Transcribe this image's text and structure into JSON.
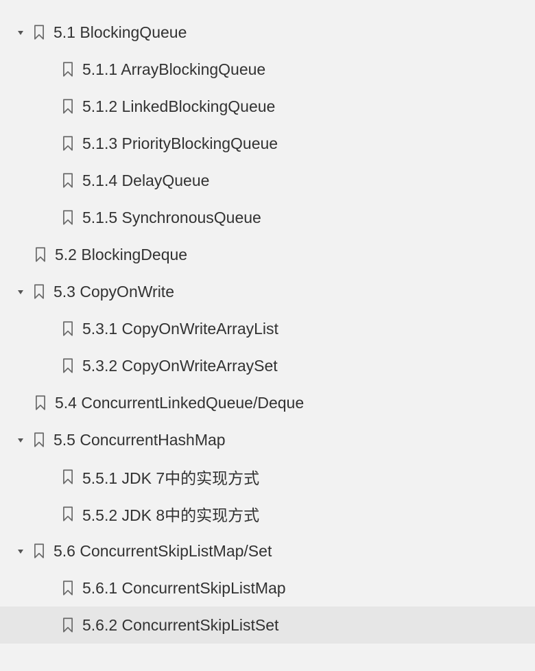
{
  "outline": [
    {
      "id": "5.1",
      "level": 1,
      "expanded": true,
      "label": "5.1 BlockingQueue"
    },
    {
      "id": "5.1.1",
      "level": 2,
      "expanded": null,
      "label": "5.1.1 ArrayBlockingQueue"
    },
    {
      "id": "5.1.2",
      "level": 2,
      "expanded": null,
      "label": "5.1.2 LinkedBlockingQueue"
    },
    {
      "id": "5.1.3",
      "level": 2,
      "expanded": null,
      "label": "5.1.3 PriorityBlockingQueue"
    },
    {
      "id": "5.1.4",
      "level": 2,
      "expanded": null,
      "label": "5.1.4 DelayQueue"
    },
    {
      "id": "5.1.5",
      "level": 2,
      "expanded": null,
      "label": "5.1.5 SynchronousQueue"
    },
    {
      "id": "5.2",
      "level": 1,
      "expanded": null,
      "label": "5.2 BlockingDeque"
    },
    {
      "id": "5.3",
      "level": 1,
      "expanded": true,
      "label": "5.3 CopyOnWrite"
    },
    {
      "id": "5.3.1",
      "level": 2,
      "expanded": null,
      "label": "5.3.1 CopyOnWriteArrayList"
    },
    {
      "id": "5.3.2",
      "level": 2,
      "expanded": null,
      "label": "5.3.2 CopyOnWriteArraySet"
    },
    {
      "id": "5.4",
      "level": 1,
      "expanded": null,
      "label": "5.4 ConcurrentLinkedQueue/Deque"
    },
    {
      "id": "5.5",
      "level": 1,
      "expanded": true,
      "label": "5.5 ConcurrentHashMap"
    },
    {
      "id": "5.5.1",
      "level": 2,
      "expanded": null,
      "label": "5.5.1 JDK 7中的实现方式"
    },
    {
      "id": "5.5.2",
      "level": 2,
      "expanded": null,
      "label": "5.5.2 JDK 8中的实现方式"
    },
    {
      "id": "5.6",
      "level": 1,
      "expanded": true,
      "label": "5.6 ConcurrentSkipListMap/Set"
    },
    {
      "id": "5.6.1",
      "level": 2,
      "expanded": null,
      "label": "5.6.1 ConcurrentSkipListMap"
    },
    {
      "id": "5.6.2",
      "level": 2,
      "expanded": null,
      "label": "5.6.2 ConcurrentSkipListSet",
      "selected": true
    }
  ]
}
